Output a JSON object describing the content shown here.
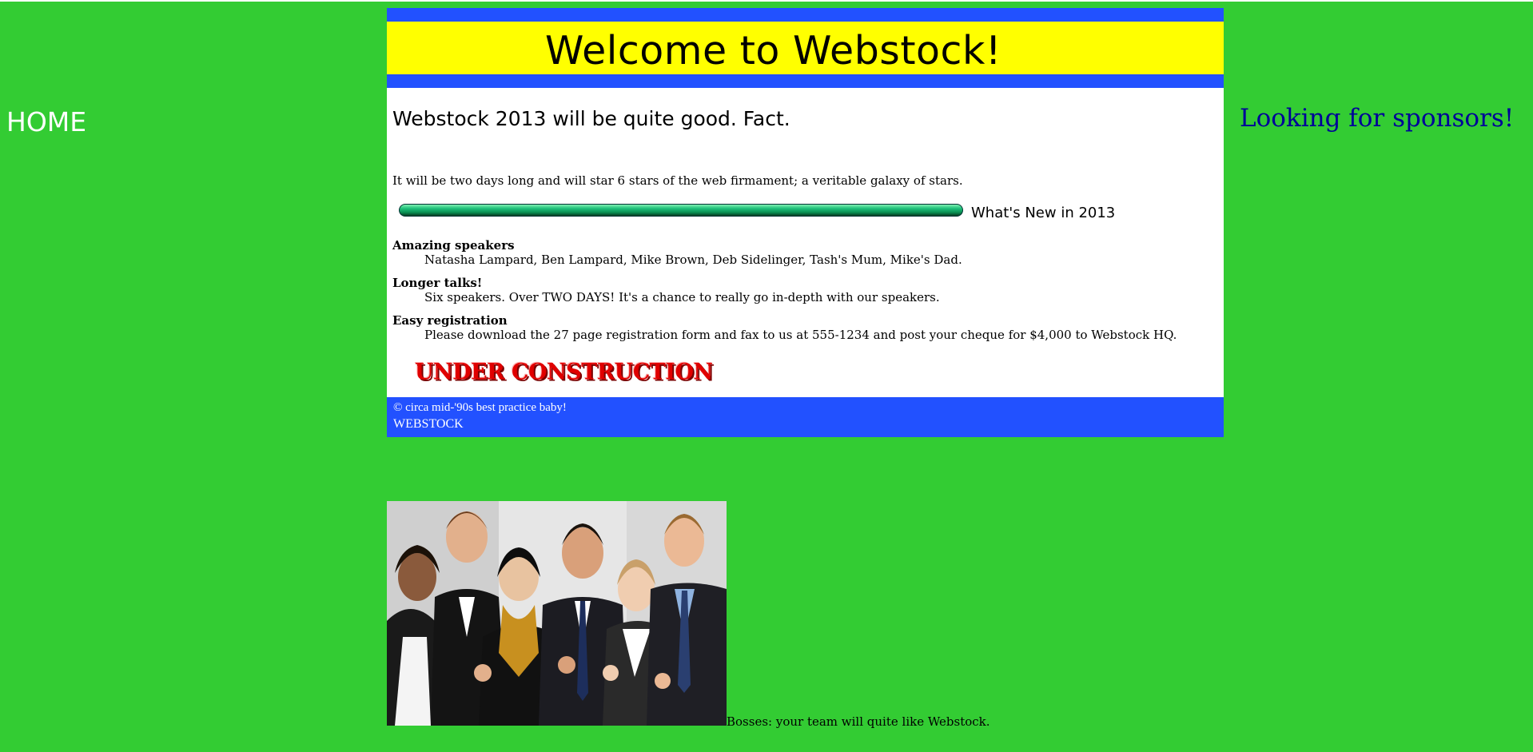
{
  "nav": {
    "home_label": "HOME"
  },
  "sidebar": {
    "sponsors_text": "Looking for sponsors!"
  },
  "header": {
    "title": "Welcome to Webstock!"
  },
  "main": {
    "lead": "Webstock 2013 will be quite good. Fact.",
    "intro": "It will be two days long and will star 6 stars of the web firmament; a veritable galaxy of stars.",
    "whats_new_heading": "What's New in 2013",
    "features": [
      {
        "term": "Amazing speakers",
        "desc": "Natasha Lampard, Ben Lampard, Mike Brown, Deb Sidelinger, Tash's Mum, Mike's Dad."
      },
      {
        "term": "Longer talks!",
        "desc": "Six speakers. Over TWO DAYS! It's a chance to really go in-depth with our speakers."
      },
      {
        "term": "Easy registration",
        "desc": "Please download the 27 page registration form and fax to us at 555-1234 and post your cheque for $4,000 to Webstock HQ."
      }
    ],
    "construction_banner": "UNDER CONSTRUCTION"
  },
  "footer": {
    "copyright": "© circa mid-'90s best practice baby!",
    "brand": "WEBSTOCK"
  },
  "photo": {
    "caption": "Bosses: your team will quite like Webstock."
  },
  "colors": {
    "page_bg": "#33cc33",
    "header_band": "#2251ff",
    "header_fill": "#ffff00",
    "sponsors_text": "#000099",
    "construction_red": "#e00000"
  }
}
